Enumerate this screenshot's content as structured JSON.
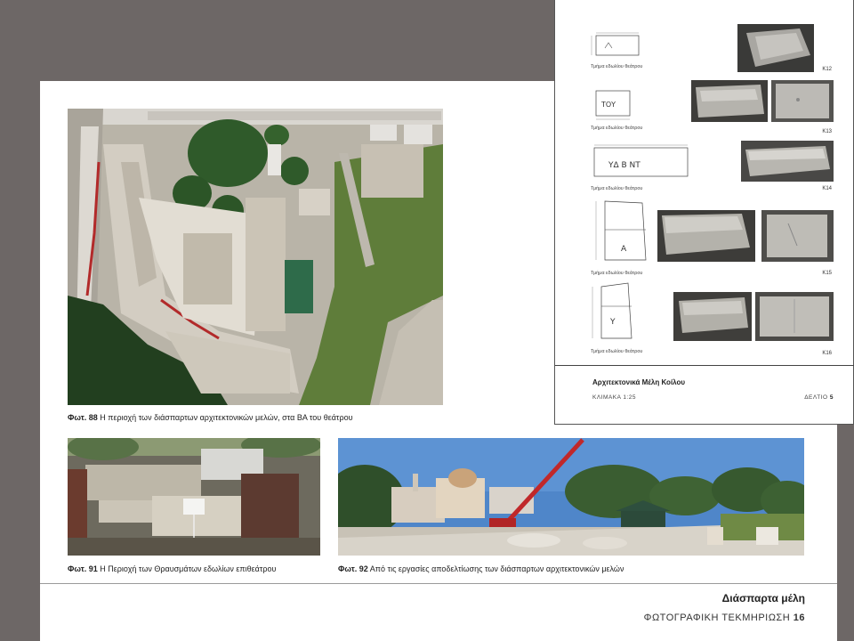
{
  "main_page": {
    "photos": [
      {
        "id": "88",
        "caption_num": "Φωτ. 88",
        "caption_text": "Η περιοχή των διάσπαρτων αρχιτεκτονικών μελών, στα ΒΑ του θεάτρου"
      },
      {
        "id": "91",
        "caption_num": "Φωτ. 91",
        "caption_text": "Η Περιοχή των Θραυσμάτων εδωλίων επιθεάτρου"
      },
      {
        "id": "92",
        "caption_num": "Φωτ. 92",
        "caption_text": "Από τις εργασίες αποδελτίωσης των διάσπαρτων αρχιτεκτονικών μελών"
      }
    ],
    "footer": {
      "title": "Διάσπαρτα μέλη",
      "subtitle": "ΦΩΤΟΓΡΑΦΙΚΗ ΤΕΚΜΗΡΙΩΣΗ",
      "page_number": "16"
    }
  },
  "drawing_sheet": {
    "rows": [
      {
        "code": "Κ12",
        "label": "Τμήμα εδωλίου θεάτρου",
        "inscription": "",
        "photos": 1
      },
      {
        "code": "Κ13",
        "label": "Τμήμα εδωλίου θεάτρου",
        "inscription": "ΤΟΥ",
        "photos": 2
      },
      {
        "code": "Κ14",
        "label": "Τμήμα εδωλίου θεάτρου",
        "inscription": "ΥΔ Β ΝΤ",
        "photos": 1
      },
      {
        "code": "Κ15",
        "label": "Τμήμα εδωλίου θεάτρου",
        "inscription": "Α",
        "photos": 2
      },
      {
        "code": "Κ16",
        "label": "Τμήμα εδωλίου θεάτρου",
        "inscription": "Υ",
        "photos": 2
      }
    ],
    "title": "Αρχιτεκτονικά Μέλη Κοίλου",
    "scale": "ΚΛΙΜΑΚΑ 1:25",
    "sheet_label": "ΔΕΛΤΙΟ",
    "sheet_number": "5"
  },
  "colors": {
    "background": "#6d6766",
    "page": "#ffffff",
    "tree_green": "#2f5a2a",
    "grass": "#5f7d3a",
    "stone": "#cfc8bd",
    "sky": "#4f86c9",
    "crane_red": "#c0282a"
  }
}
